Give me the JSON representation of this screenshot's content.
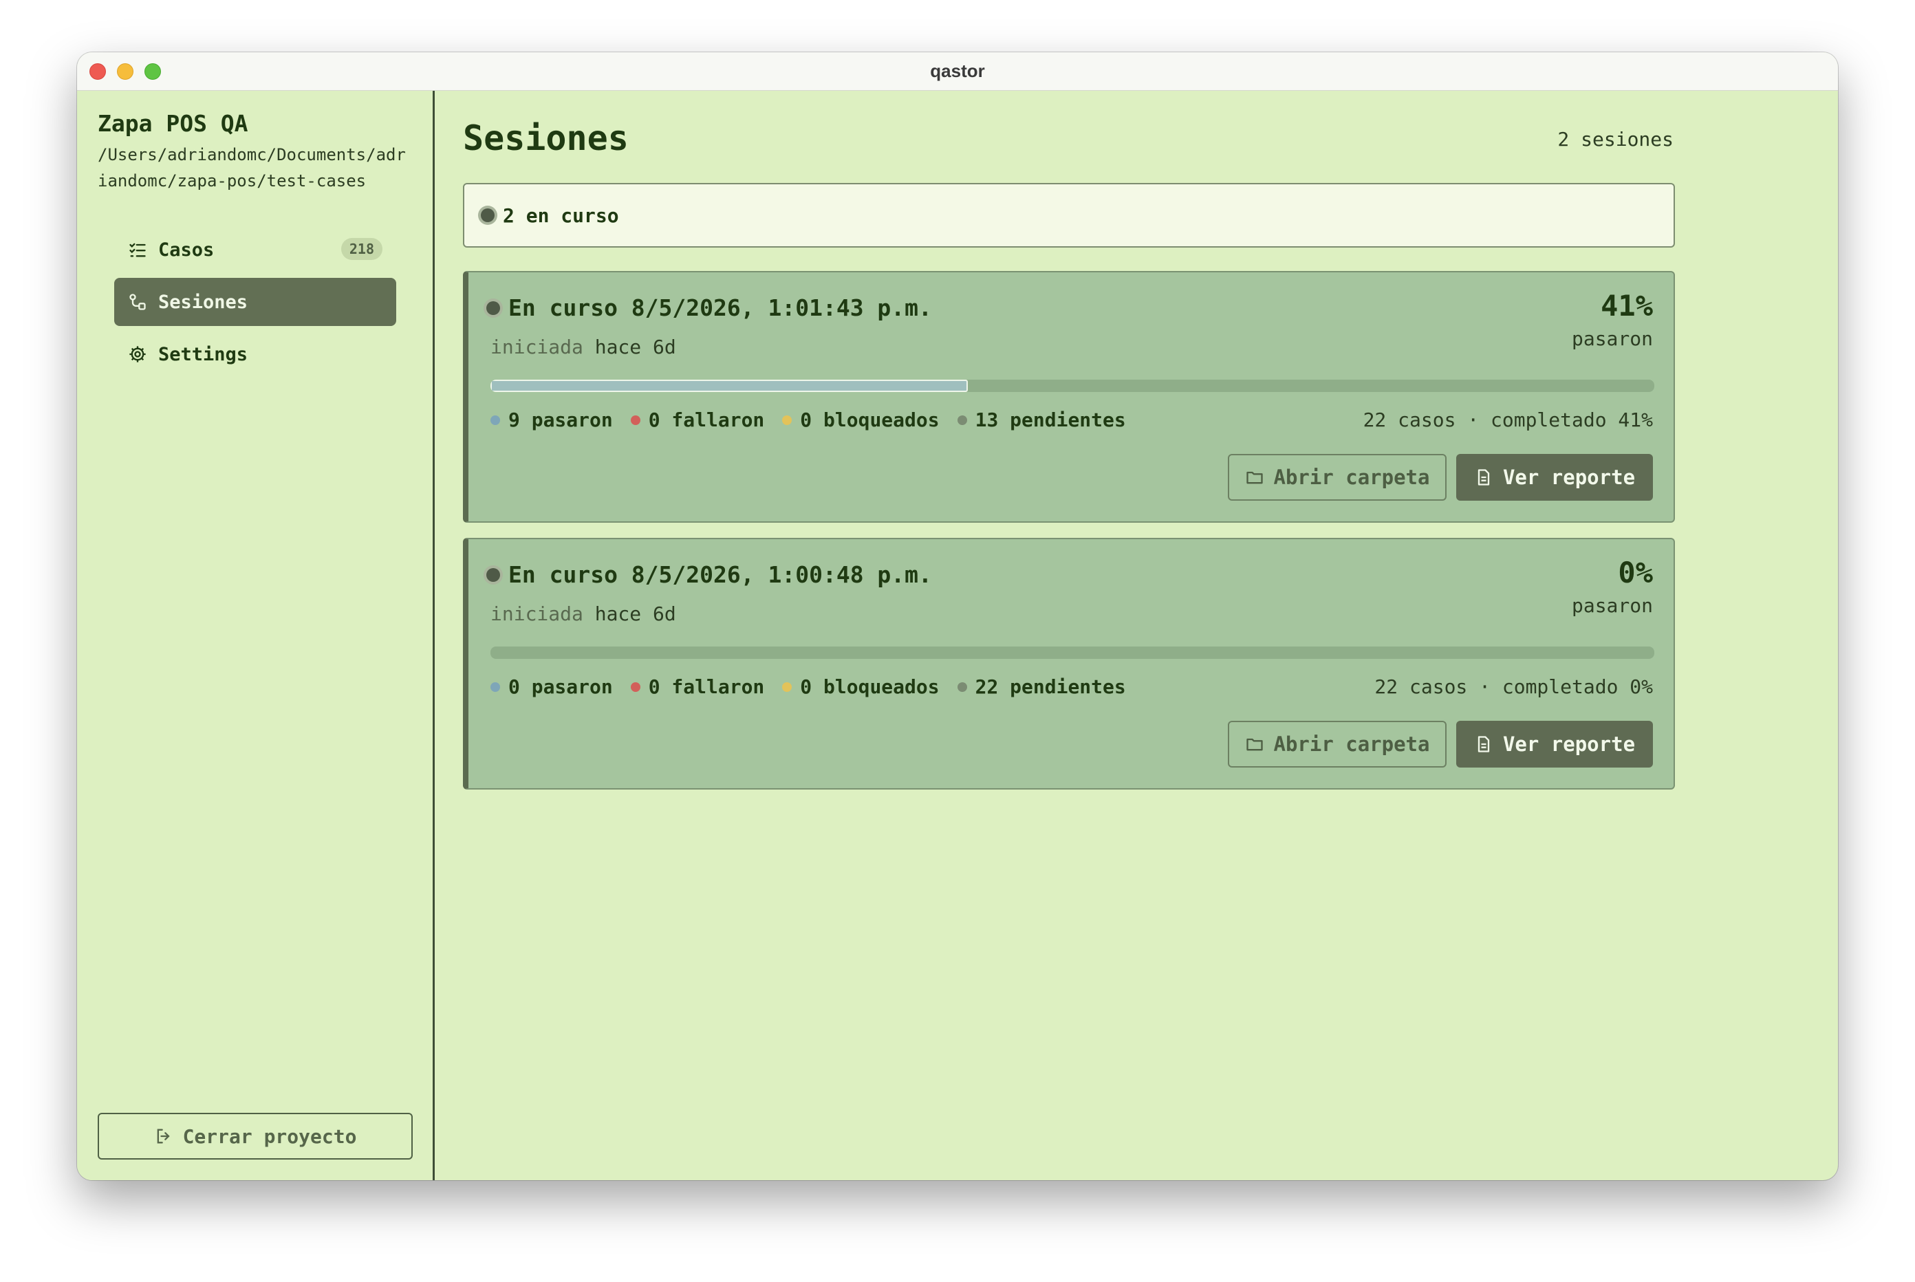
{
  "window": {
    "title": "qastor"
  },
  "sidebar": {
    "project_name": "Zapa POS QA",
    "project_path": "/Users/adriandomc/Documents/adriandomc/zapa-pos/test-cases",
    "items": [
      {
        "label": "Casos",
        "badge": "218",
        "icon": "checklist-icon",
        "active": false
      },
      {
        "label": "Sesiones",
        "icon": "sessions-icon",
        "active": true
      },
      {
        "label": "Settings",
        "icon": "gear-icon",
        "active": false
      }
    ],
    "close_label": "Cerrar proyecto"
  },
  "main": {
    "title": "Sesiones",
    "count": "2 sesiones",
    "filter_label": "2 en curso",
    "sessions": [
      {
        "title": "En curso 8/5/2026, 1:01:43 p.m.",
        "sub_muted": "iniciada",
        "sub_text": "hace 6d",
        "percent": "41%",
        "percent_label": "pasaron",
        "progress": 0.41,
        "stats": {
          "passed": "9 pasaron",
          "failed": "0 fallaron",
          "blocked": "0 bloqueados",
          "pending": "13 pendientes"
        },
        "summary": "22 casos · completado 41%",
        "folder_label": "Abrir carpeta",
        "report_label": "Ver reporte"
      },
      {
        "title": "En curso 8/5/2026, 1:00:48 p.m.",
        "sub_muted": "iniciada",
        "sub_text": "hace 6d",
        "percent": "0%",
        "percent_label": "pasaron",
        "progress": 0,
        "stats": {
          "passed": "0 pasaron",
          "failed": "0 fallaron",
          "blocked": "0 bloqueados",
          "pending": "22 pendientes"
        },
        "summary": "22 casos · completado 0%",
        "folder_label": "Abrir carpeta",
        "report_label": "Ver reporte"
      }
    ]
  },
  "colors": {
    "background": "#ddf0c1",
    "card": "#a5c59e",
    "accent": "#626f54",
    "passed": "#7ea6b8",
    "failed": "#d2605a",
    "blocked": "#e3c35a",
    "pending": "#7b8c73"
  }
}
